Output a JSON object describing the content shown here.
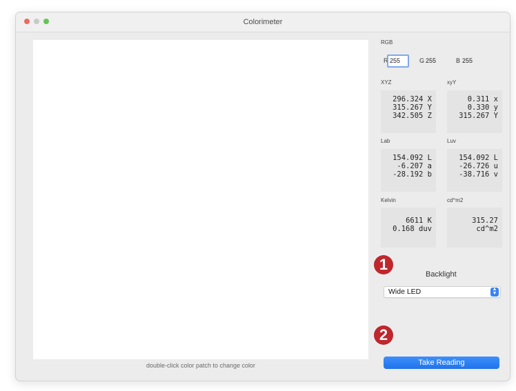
{
  "window": {
    "title": "Colorimeter"
  },
  "patch": {
    "color": "#ffffff",
    "hint": "double-click color patch to change color"
  },
  "rgb": {
    "label": "RGB",
    "r_letter": "R",
    "r": "255",
    "g_letter": "G",
    "g": "255",
    "b_letter": "B",
    "b": "255"
  },
  "xyz": {
    "label": "XYZ",
    "rows": [
      "296.324 X",
      "315.267 Y",
      "342.505 Z"
    ]
  },
  "xyY": {
    "label": "xyY",
    "rows": [
      "0.311 x",
      "0.330 y",
      "315.267 Y"
    ]
  },
  "lab": {
    "label": "Lab",
    "rows": [
      "154.092 L",
      "-6.207 a",
      "-28.192 b"
    ]
  },
  "luv": {
    "label": "Luv",
    "rows": [
      "154.092 L",
      "-26.726 u",
      "-38.716 v"
    ]
  },
  "kelvin": {
    "label": "Kelvin",
    "rows": [
      "6611 K",
      "0.168 duv"
    ]
  },
  "cdm2": {
    "label": "cd^m2",
    "rows": [
      "315.27",
      "cd^m2"
    ]
  },
  "markers": {
    "one": "1",
    "two": "2"
  },
  "backlight": {
    "label": "Backlight",
    "selected": "Wide LED"
  },
  "take_reading": {
    "label": "Take Reading"
  },
  "colors": {
    "accent": "#1f73ea",
    "marker": "#c0262d"
  }
}
